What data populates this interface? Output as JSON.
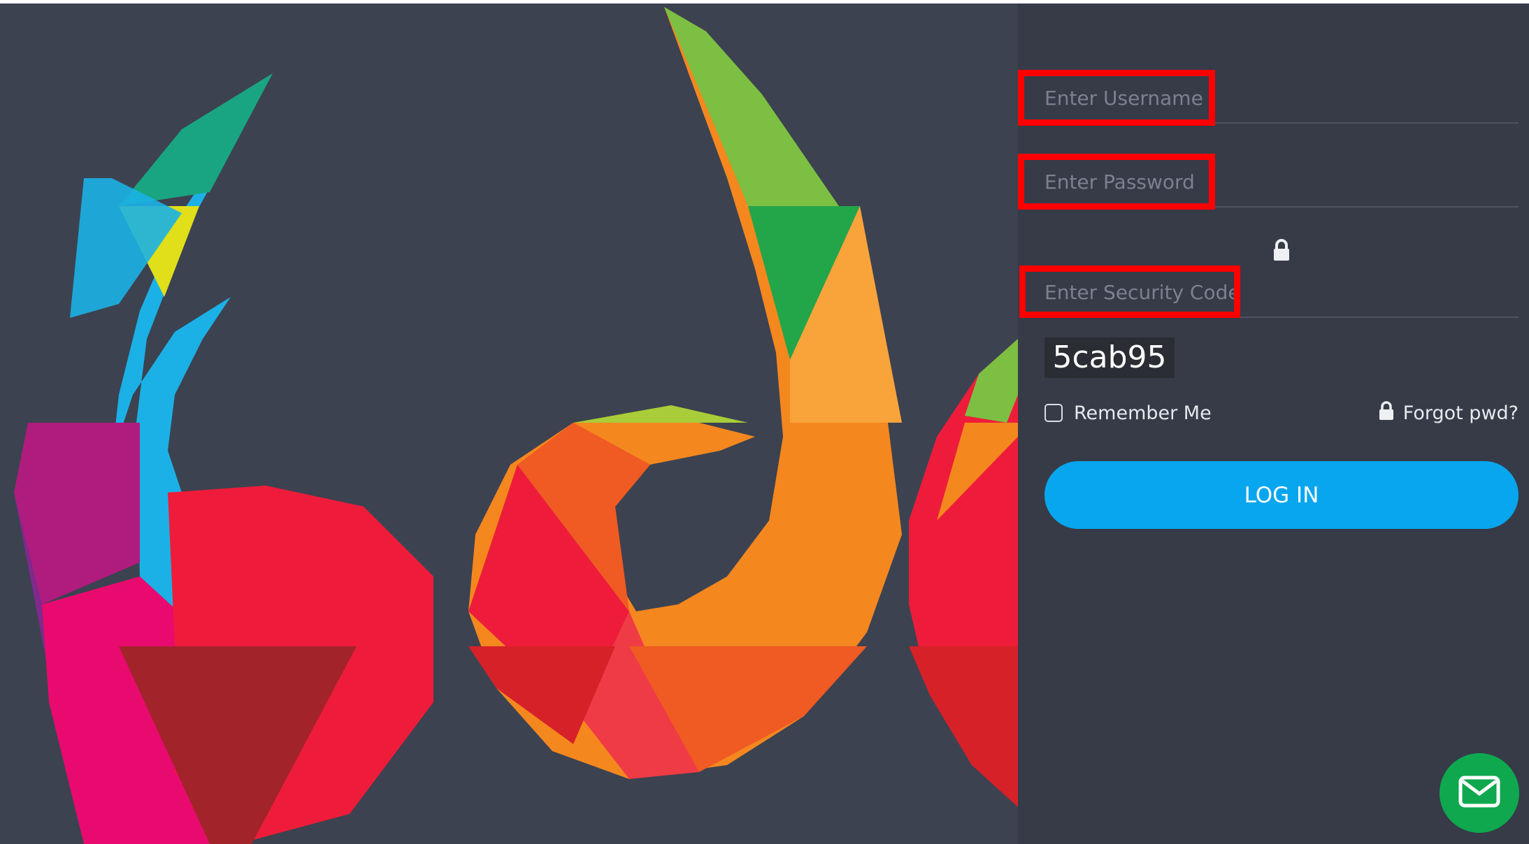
{
  "login_form": {
    "username_placeholder": "Enter Username",
    "password_placeholder": "Enter Password",
    "security_code_placeholder": "Enter Security Code",
    "captcha_code": "5cab95",
    "remember_label": "Remember Me",
    "forgot_label": "Forgot pwd?",
    "login_label": "LOG IN"
  },
  "icons": {
    "lock": "lock-icon",
    "mail": "mail-icon"
  },
  "colors": {
    "panel_background": "#363b47",
    "art_background": "#3c4250",
    "login_button": "#08a6ee",
    "mail_button": "#0fa84f",
    "highlight_border": "#ff0000"
  }
}
